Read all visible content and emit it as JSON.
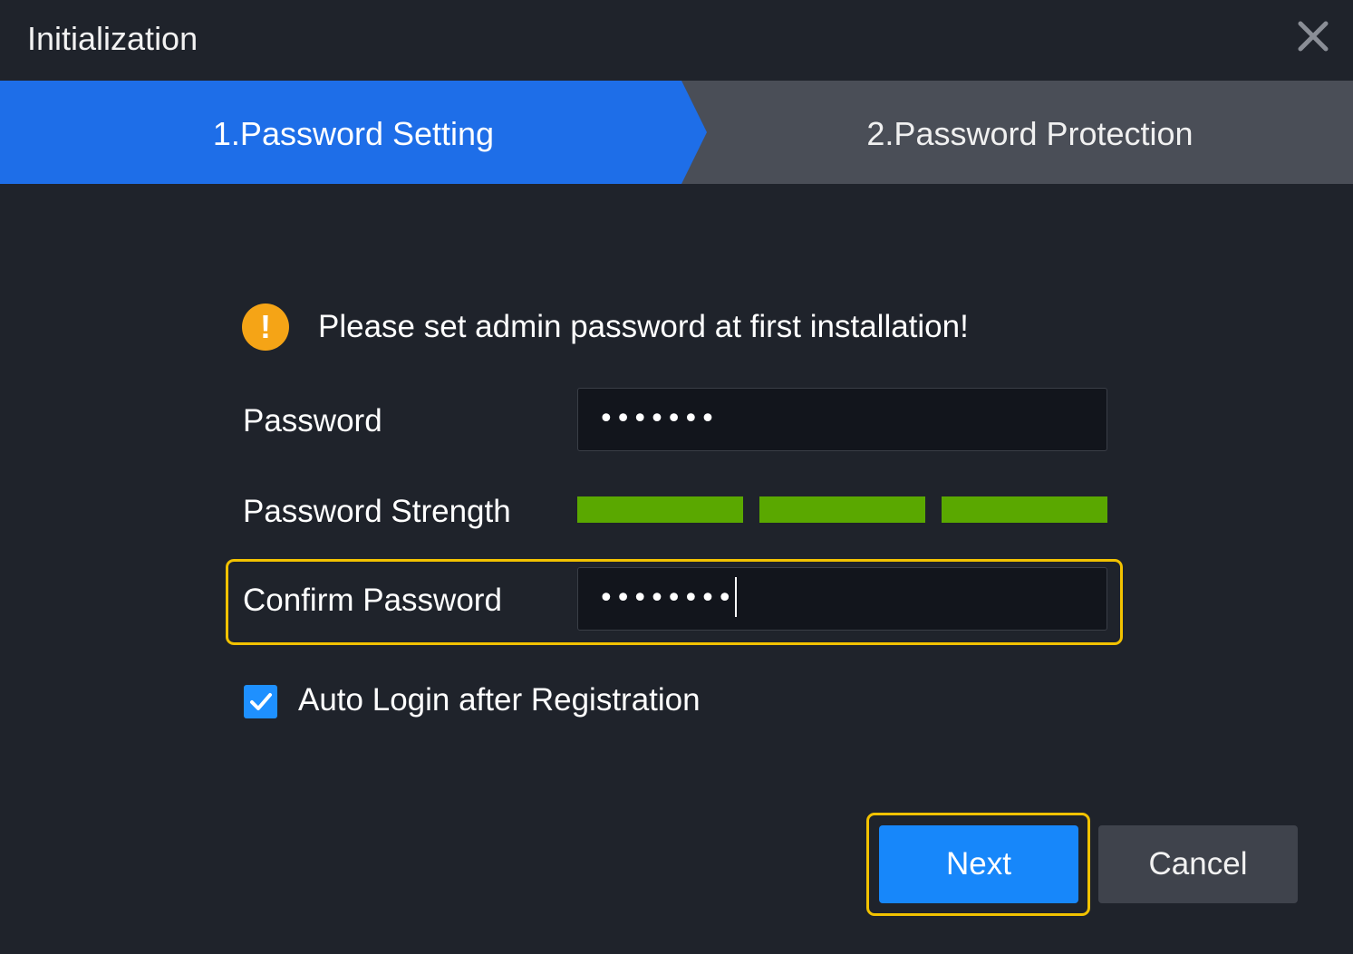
{
  "window": {
    "title": "Initialization",
    "close_icon": "close-icon"
  },
  "steps": [
    {
      "label": "1.Password Setting",
      "active": true
    },
    {
      "label": "2.Password Protection",
      "active": false
    }
  ],
  "notice": {
    "icon": "warning-icon",
    "icon_glyph": "!",
    "text": "Please set admin password at first installation!"
  },
  "form": {
    "password_label": "Password",
    "password_value": "•••••••",
    "strength_label": "Password Strength",
    "strength_level": "3/3",
    "confirm_label": "Confirm Password",
    "confirm_value": "••••••••",
    "auto_login_label": "Auto Login after Registration",
    "auto_login_checked": true
  },
  "buttons": {
    "next": "Next",
    "cancel": "Cancel"
  },
  "colors": {
    "background": "#1f232b",
    "active_step": "#1e6ee8",
    "inactive_step": "#4a4e57",
    "strength_fill": "#5aa800",
    "warning": "#f5a416",
    "primary_button": "#1787fa",
    "highlight": "#f2c200"
  }
}
